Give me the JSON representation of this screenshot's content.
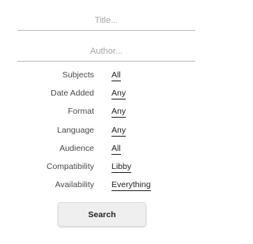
{
  "search": {
    "title_placeholder": "Title...",
    "title_value": "",
    "author_placeholder": "Author...",
    "author_value": ""
  },
  "filters": [
    {
      "label": "Subjects",
      "value": "All"
    },
    {
      "label": "Date Added",
      "value": "Any"
    },
    {
      "label": "Format",
      "value": "Any"
    },
    {
      "label": "Language",
      "value": "Any"
    },
    {
      "label": "Audience",
      "value": "All"
    },
    {
      "label": "Compatibility",
      "value": "Libby"
    },
    {
      "label": "Availability",
      "value": "Everything"
    }
  ],
  "actions": {
    "search_label": "Search"
  }
}
